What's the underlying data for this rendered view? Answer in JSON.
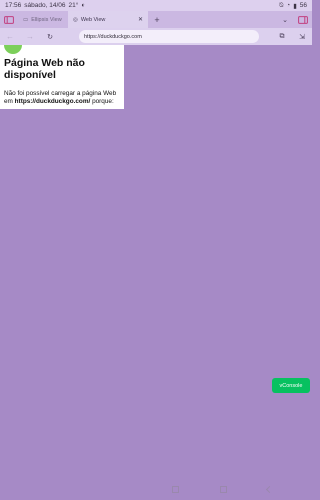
{
  "status": {
    "time": "17:56",
    "date": "sábado, 14/06",
    "temp": "21°",
    "battery": "56"
  },
  "tabs": [
    {
      "title": "Ellipsis View"
    },
    {
      "title": "Web View"
    }
  ],
  "toolbar": {
    "url": "https://duckduckgo.com"
  },
  "error": {
    "title": "Página Web não disponível",
    "prefix": "Não foi possível carregar a página Web em ",
    "url": "https://duckduckgo.com/",
    "suffix": " porque:"
  },
  "vconsole": {
    "label": "vConsole"
  },
  "colors": {
    "accent": "#07c160",
    "page_bg": "#a68ac6"
  }
}
